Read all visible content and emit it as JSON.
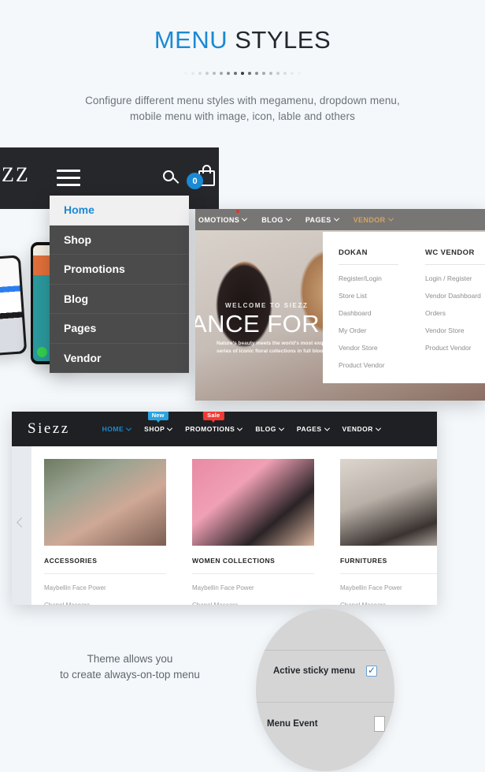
{
  "header": {
    "title_accent": "MENU",
    "title_plain": "STYLES",
    "subtitle_line1": "Configure different menu styles with megamenu, dropdown menu,",
    "subtitle_line2": "mobile menu with image, icon, lable and others",
    "accent_color": "#1b8ad4",
    "background_color": "#f4f8fb",
    "dots_count": 17,
    "dots_active_index": 8
  },
  "mobile_header": {
    "logo_fragment": "ZZ",
    "menu_icon": "hamburger-icon",
    "search_icon": "search-icon",
    "cart_icon": "shopping-bag-icon",
    "cart_count": "0",
    "cart_badge_color": "#1b8ad4"
  },
  "mobile_menu": {
    "items": [
      {
        "label": "Home",
        "active": true
      },
      {
        "label": "Shop",
        "active": false
      },
      {
        "label": "Promotions",
        "active": false
      },
      {
        "label": "Blog",
        "active": false
      },
      {
        "label": "Pages",
        "active": false
      },
      {
        "label": "Vendor",
        "active": false
      }
    ]
  },
  "hero_panel": {
    "nav": [
      {
        "label": "OMOTIONS",
        "highlight": false
      },
      {
        "label": "BLOG",
        "highlight": false
      },
      {
        "label": "PAGES",
        "highlight": false
      },
      {
        "label": "VENDOR",
        "highlight": true
      }
    ],
    "highlight_color": "#d3a463",
    "welcome_text": "WELCOME TO SIEZZ",
    "headline": "ANCE FOR",
    "desc_line1": "Nature's beauty meets the world's most exquisite",
    "desc_line2": "series of iconic floral collections in full bloom in"
  },
  "megamenu": {
    "columns": [
      {
        "heading": "DOKAN",
        "links": [
          "Register/Login",
          "Store List",
          "Dashboard",
          "My Order",
          "Vendor Store",
          "Product Vendor"
        ]
      },
      {
        "heading": "WC VENDOR",
        "links": [
          "Login / Register",
          "Vendor Dashboard",
          "Orders",
          "Vendor Store",
          "Product Vendor"
        ]
      }
    ]
  },
  "siezz_page": {
    "brand": "Siezz",
    "nav": [
      {
        "label": "HOME",
        "active": true,
        "flag": null
      },
      {
        "label": "SHOP",
        "active": false,
        "flag": "New",
        "flag_type": "new"
      },
      {
        "label": "PROMOTIONS",
        "active": false,
        "flag": "Sale",
        "flag_type": "sale"
      },
      {
        "label": "BLOG",
        "active": false,
        "flag": null
      },
      {
        "label": "PAGES",
        "active": false,
        "flag": null
      },
      {
        "label": "VENDOR",
        "active": false,
        "flag": null
      }
    ],
    "categories": [
      {
        "title": "ACCESSORIES",
        "links": [
          "Maybellin Face Power",
          "Chanel Mascara"
        ]
      },
      {
        "title": "WOMEN COLLECTIONS",
        "links": [
          "Maybellin Face Power",
          "Chanel Mascara"
        ]
      },
      {
        "title": "FURNITURES",
        "links": [
          "Maybellin Face Power",
          "Chanel Mascara"
        ]
      }
    ]
  },
  "sticky_callout": {
    "text_line1": "Theme allows you",
    "text_line2": "to create always-on-top menu",
    "setting_label": "Active sticky menu",
    "setting_checked": true,
    "second_label": "Menu Event"
  }
}
